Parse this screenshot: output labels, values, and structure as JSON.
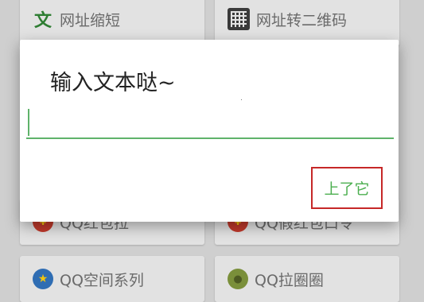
{
  "background": {
    "cards": [
      {
        "label": "网址缩短",
        "icon": "wen-character-icon",
        "glyph": "文"
      },
      {
        "label": "网址转二维码",
        "icon": "qrcode-icon",
        "glyph": ""
      },
      {
        "label": "QQ红包拉",
        "icon": "red-packet-icon",
        "glyph": "¥"
      },
      {
        "label": "QQ假红包口令",
        "icon": "red-packet-icon",
        "glyph": "¥"
      },
      {
        "label": "QQ空间系列",
        "icon": "star-icon",
        "glyph": "★"
      },
      {
        "label": "QQ拉圈圈",
        "icon": "frog-icon",
        "glyph": "●"
      }
    ]
  },
  "dialog": {
    "title": "输入文本哒~",
    "input_value": "",
    "submit_label": "上了它"
  },
  "colors": {
    "accent_green": "#4caf50",
    "highlight_red": "#c62828"
  }
}
